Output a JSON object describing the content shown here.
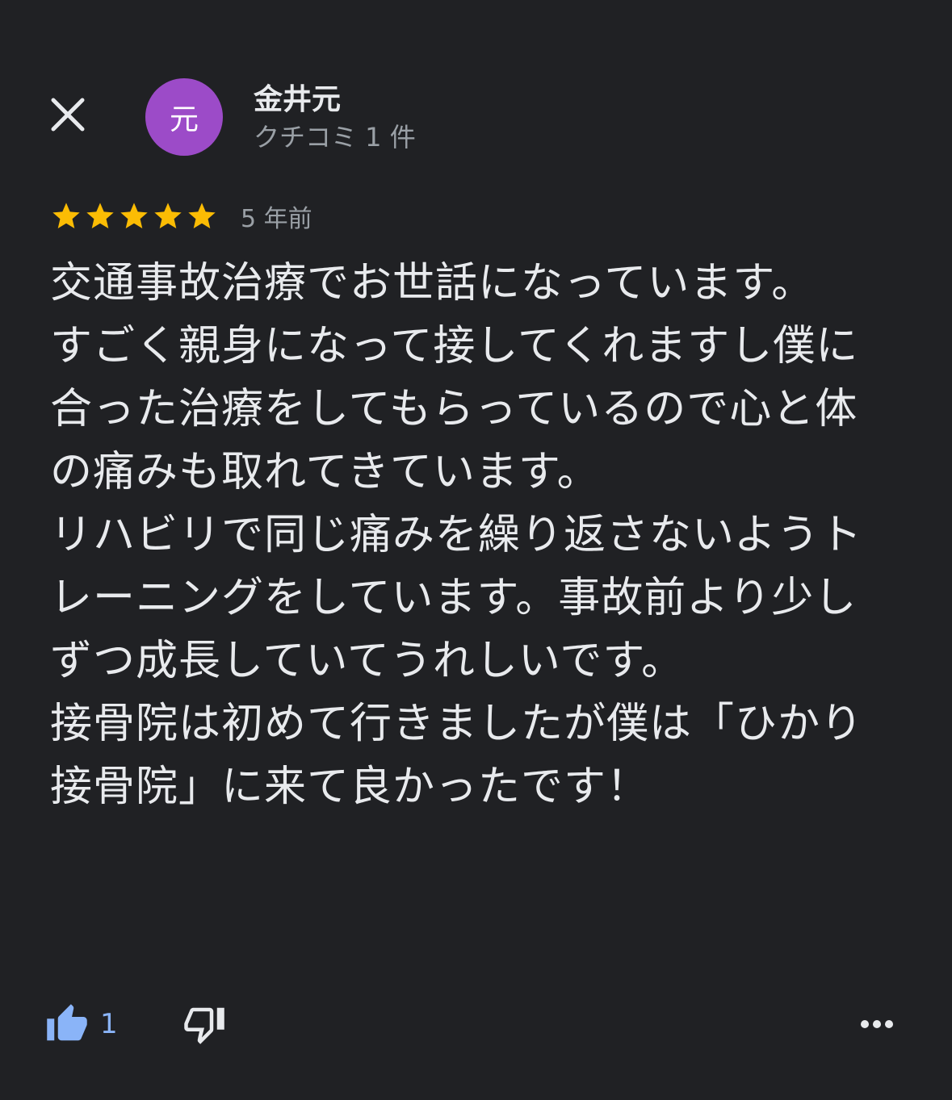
{
  "header": {
    "close_icon": "close-icon",
    "avatar": {
      "initial": "元",
      "color": "#9c4bc8"
    }
  },
  "reviewer": {
    "name": "金井元",
    "review_count": "クチコミ 1 件"
  },
  "review": {
    "rating": 5,
    "max_rating": 5,
    "star_color": "#fbbc04",
    "date": "5 年前",
    "text": "交通事故治療でお世話になっています。\nすごく親身になって接してくれますし僕に合った治療をしてもらっているので心と体の痛みも取れてきています。\nリハビリで同じ痛みを繰り返さないようトレーニングをしています。事故前より少しずつ成長していてうれしいです。\n接骨院は初めて行きましたが僕は「ひかり接骨院」に来て良かったです！"
  },
  "actions": {
    "like_icon": "thumbs-up-icon",
    "like_count": "1",
    "like_color": "#8ab4f8",
    "dislike_icon": "thumbs-down-icon",
    "more_icon": "more-horizontal-icon"
  }
}
